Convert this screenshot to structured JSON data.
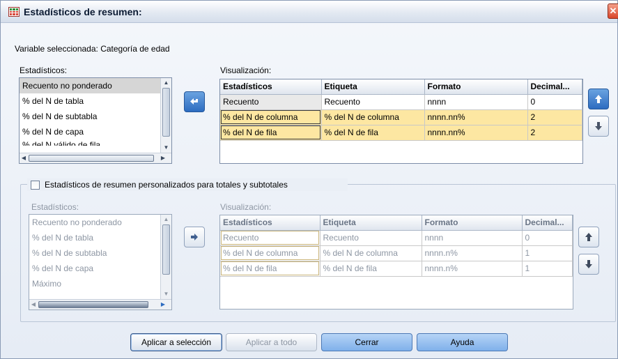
{
  "window": {
    "title": "Estadísticos de resumen:",
    "close_glyph": "✕"
  },
  "selected_variable": "Variable seleccionada: Categoría de edad",
  "top": {
    "stats_label": "Estadísticos:",
    "stats_items": [
      "Recuento no ponderado",
      "% del N de tabla",
      "% del N de subtabla",
      "% del N de capa",
      "% del N válido de fila"
    ],
    "display_label": "Visualización:",
    "columns": [
      "Estadísticos",
      "Etiqueta",
      "Formato",
      "Decimal..."
    ],
    "rows": [
      [
        "Recuento",
        "Recuento",
        "nnnn",
        "0"
      ],
      [
        "% del N de columna",
        "% del N de columna",
        "nnnn.nn%",
        "2"
      ],
      [
        "% del N de fila",
        "% del N de fila",
        "nnnn.nn%",
        "2"
      ]
    ]
  },
  "custom": {
    "checkbox_label": "Estadísticos de resumen personalizados para totales y subtotales",
    "checked": false,
    "stats_label": "Estadísticos:",
    "stats_items": [
      "Recuento no ponderado",
      "% del N de tabla",
      "% del N de subtabla",
      "% del N de capa",
      "Máximo"
    ],
    "display_label": "Visualización:",
    "columns": [
      "Estadísticos",
      "Etiqueta",
      "Formato",
      "Decimal..."
    ],
    "rows": [
      [
        "Recuento",
        "Recuento",
        "nnnn",
        "0"
      ],
      [
        "% del N de columna",
        "% del N de columna",
        "nnnn.n%",
        "1"
      ],
      [
        "% del N de fila",
        "% del N de fila",
        "nnnn.n%",
        "1"
      ]
    ]
  },
  "buttons": {
    "apply_selection": "Aplicar a selección",
    "apply_all": "Aplicar a todo",
    "close": "Cerrar",
    "help": "Ayuda"
  },
  "colors": {
    "highlight_row": "#fde7a2",
    "accent_blue": "#2d6cc0"
  }
}
